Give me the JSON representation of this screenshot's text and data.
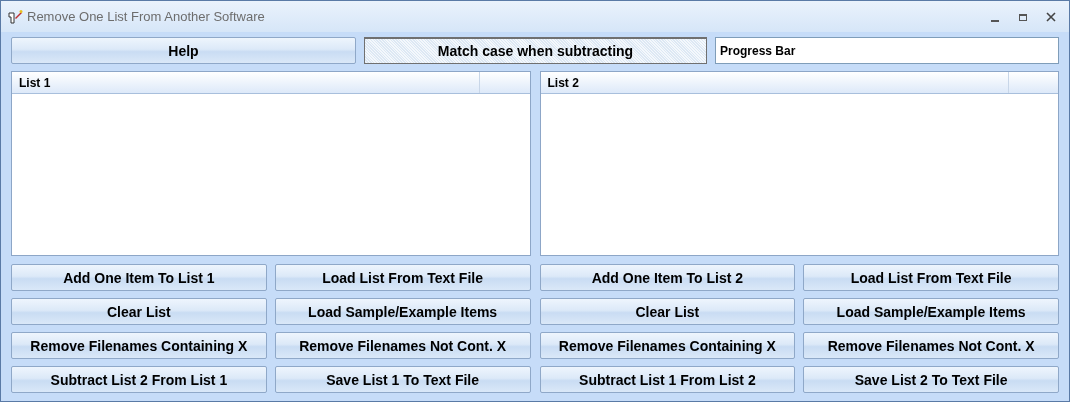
{
  "window": {
    "title": "Remove One List From Another Software"
  },
  "toolbar": {
    "help": "Help",
    "match_case": {
      "label": "Match case when subtracting",
      "checked": true
    },
    "progress": "Progress Bar"
  },
  "lists": [
    {
      "header": "List 1",
      "buttons": [
        "Add One Item To List 1",
        "Load List From Text File",
        "Clear List",
        "Load Sample/Example Items",
        "Remove Filenames Containing X",
        "Remove Filenames Not Cont. X",
        "Subtract List 2 From List 1",
        "Save List 1 To Text File"
      ]
    },
    {
      "header": "List 2",
      "buttons": [
        "Add One Item To List 2",
        "Load List From Text File",
        "Clear List",
        "Load Sample/Example Items",
        "Remove Filenames Containing X",
        "Remove Filenames Not Cont. X",
        "Subtract List 1 From List 2",
        "Save List 2 To Text File"
      ]
    }
  ]
}
